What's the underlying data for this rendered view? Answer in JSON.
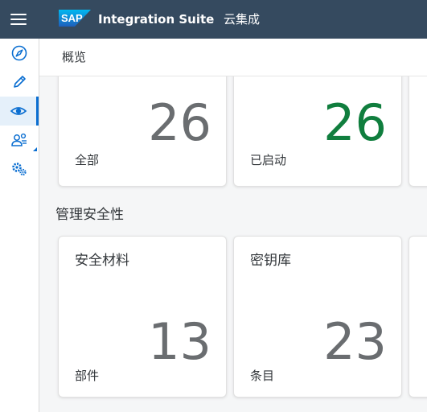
{
  "shell": {
    "product_name": "Integration Suite",
    "product_subtitle": "云集成",
    "logo_text": "SAP",
    "bar_color": "#354a5f"
  },
  "sidebar": {
    "items": [
      {
        "icon": "compass-icon",
        "active": false
      },
      {
        "icon": "pencil-icon",
        "active": false
      },
      {
        "icon": "eye-icon",
        "active": true
      },
      {
        "icon": "manage-users-icon",
        "active": false,
        "expandable": true
      },
      {
        "icon": "gears-icon",
        "active": false
      }
    ]
  },
  "page": {
    "title": "概览"
  },
  "top_tiles": [
    {
      "value": "26",
      "unit": "全部",
      "value_color": "#6a6d70"
    },
    {
      "value": "26",
      "unit": "已启动",
      "value_color": "#107e3e"
    }
  ],
  "security": {
    "section_title": "管理安全性",
    "tiles": [
      {
        "title": "安全材料",
        "value": "13",
        "unit": "部件"
      },
      {
        "title": "密钥库",
        "value": "23",
        "unit": "条目"
      }
    ]
  },
  "colors": {
    "accent": "#0a6ed1",
    "success": "#107e3e",
    "neutral_number": "#6a6d70"
  }
}
